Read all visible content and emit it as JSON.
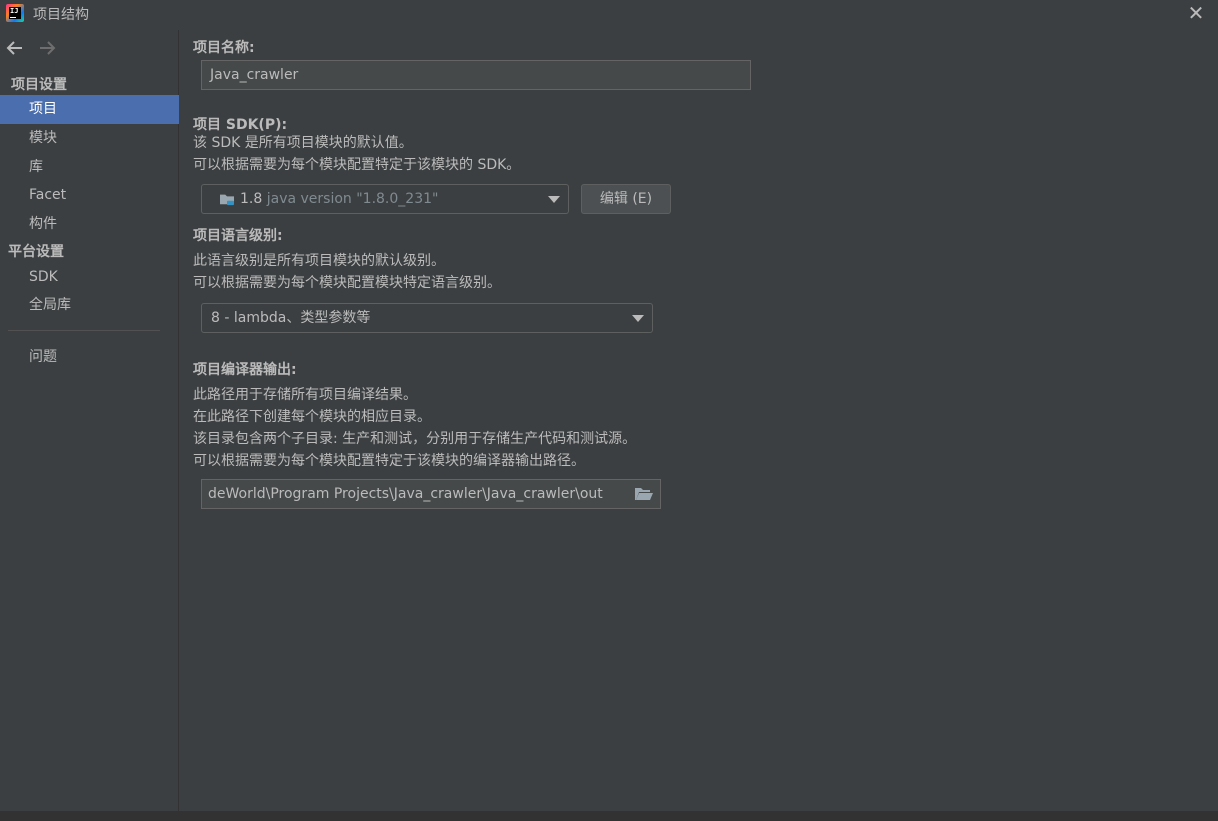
{
  "window": {
    "title": "项目结构",
    "app_icon": "intellij-idea-icon",
    "close_icon": "close-icon"
  },
  "sidebar": {
    "back_icon": "arrow-left-icon",
    "forward_icon": "arrow-right-icon",
    "section_project_settings": "项目设置",
    "project_items": [
      {
        "label": "项目",
        "selected": true
      },
      {
        "label": "模块",
        "selected": false
      },
      {
        "label": "库",
        "selected": false
      },
      {
        "label": "Facet",
        "selected": false
      },
      {
        "label": "构件",
        "selected": false
      }
    ],
    "section_platform_settings": "平台设置",
    "platform_items": [
      {
        "label": "SDK"
      },
      {
        "label": "全局库"
      }
    ],
    "problems_label": "问题"
  },
  "main": {
    "project_name_label": "项目名称:",
    "project_name_value": "Java_crawler",
    "sdk_label": "项目 SDK(P):",
    "sdk_desc_line1": "该 SDK 是所有项目模块的默认值。",
    "sdk_desc_line2": "可以根据需要为每个模块配置特定于该模块的 SDK。",
    "sdk_selected_name": "1.8",
    "sdk_selected_version": "java version \"1.8.0_231\"",
    "sdk_edit_button": "编辑 (E)",
    "language_level_label": "项目语言级别:",
    "language_desc_line1": "此语言级别是所有项目模块的默认级别。",
    "language_desc_line2": "可以根据需要为每个模块配置模块特定语言级别。",
    "language_level_value": "8 - lambda、类型参数等",
    "compiler_output_label": "项目编译器输出:",
    "compiler_desc_line1": "此路径用于存储所有项目编译结果。",
    "compiler_desc_line2": "在此路径下创建每个模块的相应目录。",
    "compiler_desc_line3": "该目录包含两个子目录: 生产和测试，分别用于存储生产代码和测试源。",
    "compiler_desc_line4": "可以根据需要为每个模块配置特定于该模块的编译器输出路径。",
    "compiler_output_path": "deWorld\\Program Projects\\Java_crawler\\Java_crawler\\out"
  },
  "colors": {
    "background": "#3c3f41",
    "selection": "#4b6eaf",
    "text": "#bbbbbb",
    "input_bg": "#45494a"
  }
}
